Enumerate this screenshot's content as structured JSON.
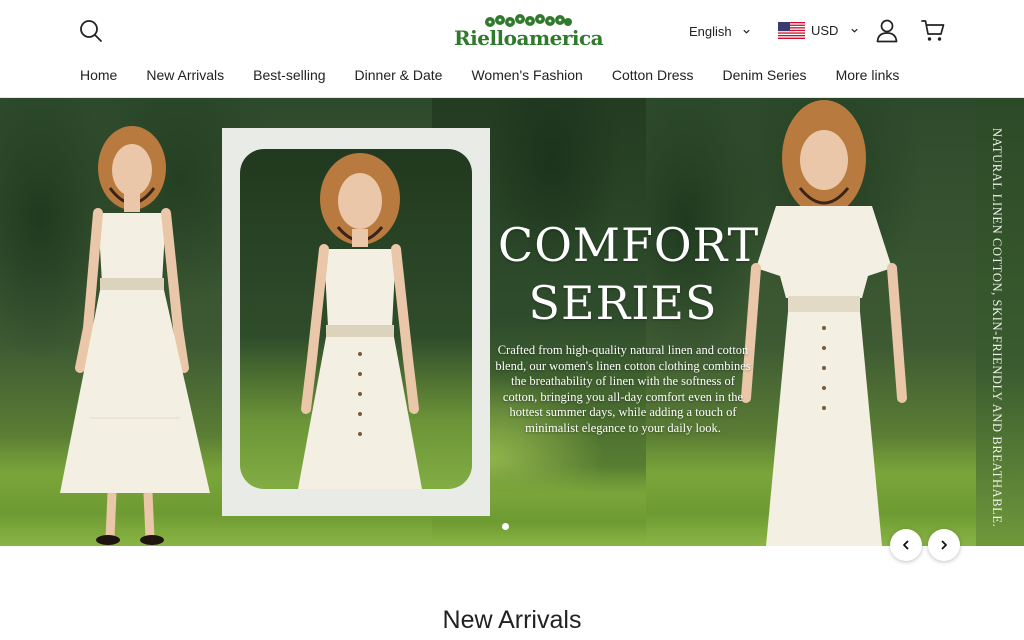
{
  "header": {
    "logo_text": "Rielloamerica",
    "language": "English",
    "currency": "USD"
  },
  "nav": {
    "items": [
      {
        "label": "Home"
      },
      {
        "label": "New Arrivals"
      },
      {
        "label": "Best-selling"
      },
      {
        "label": "Dinner & Date"
      },
      {
        "label": "Women's Fashion"
      },
      {
        "label": "Cotton Dress"
      },
      {
        "label": "Denim Series"
      },
      {
        "label": "More links"
      }
    ]
  },
  "hero": {
    "title_line1": "COMFORT",
    "title_line2": "SERIES",
    "description": "Crafted from high-quality natural linen and cotton blend, our women's linen cotton clothing combines the breathability of linen with the softness of cotton, bringing you all-day comfort even in the hottest summer days, while adding a touch of minimalist elegance to your daily look.",
    "side_text": "NATURAL LINEN COTTON, SKIN-FRIENDLY AND BREATHABLE."
  },
  "section": {
    "title": "New Arrivals"
  },
  "colors": {
    "brand_green": "#2f7a2c",
    "text": "#222222",
    "dress": "#f4efe3"
  },
  "icons": [
    "search-icon",
    "chevron-down-icon",
    "us-flag-icon",
    "user-icon",
    "cart-icon",
    "chevron-left-icon",
    "chevron-right-icon"
  ]
}
